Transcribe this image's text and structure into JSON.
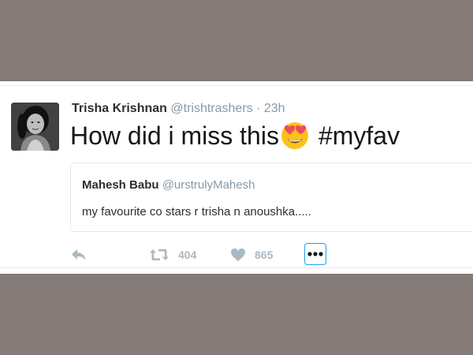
{
  "tweet": {
    "author_name": "Trisha Krishnan",
    "author_handle": "@trishtrashers",
    "separator": "·",
    "time": "23h",
    "text_before_emoji": "How did i miss this",
    "text_after_emoji": "#myfav",
    "emoji": "smiling-face-with-heart-eyes"
  },
  "quoted_tweet": {
    "author_name": "Mahesh Babu",
    "author_handle": "@urstrulyMahesh",
    "text": "my favourite co stars r trisha n anoushka....."
  },
  "actions": {
    "retweet_count": "404",
    "like_count": "865"
  },
  "colors": {
    "background_band": "#857b79",
    "card": "#ffffff",
    "muted_text": "#8899a6",
    "action_gray": "#aab8c2",
    "accent_blue": "#1da1f2"
  }
}
